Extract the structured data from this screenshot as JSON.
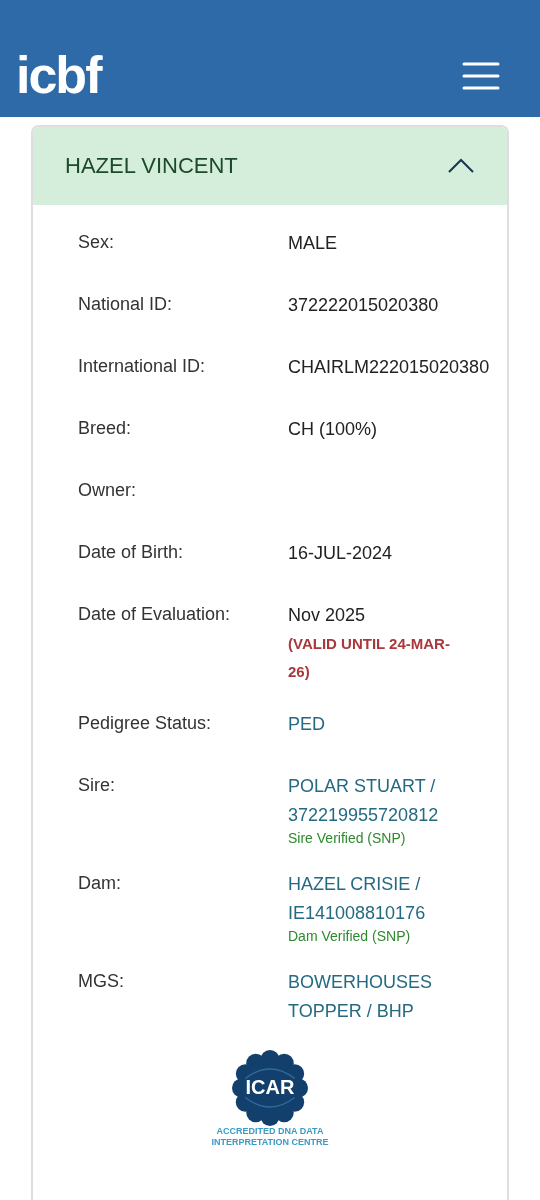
{
  "header": {
    "logo": "icbf"
  },
  "card": {
    "title": "HAZEL VINCENT",
    "expanded": true,
    "rows": [
      {
        "label": "Sex:",
        "value": "MALE",
        "kind": "plain"
      },
      {
        "label": "National ID:",
        "value": "372222015020380",
        "kind": "plain"
      },
      {
        "label": "International ID:",
        "value": "CHAIRLM222015020380",
        "kind": "plain"
      },
      {
        "label": "Breed:",
        "value": "CH (100%)",
        "kind": "plain"
      },
      {
        "label": "Owner:"
      },
      {
        "label": "Date of Birth:",
        "value": "16-JUL-2024",
        "kind": "plain"
      },
      {
        "label": "Date of Evaluation:",
        "value": "Nov 2025",
        "kind": "plain",
        "note": "(VALID UNTIL 24-MAR-26)"
      },
      {
        "label": "Pedigree Status:",
        "value": "PED",
        "kind": "link"
      },
      {
        "label": "Sire:",
        "value": "POLAR STUART / 372219955720812",
        "kind": "link",
        "verification": "Sire Verified (SNP)"
      },
      {
        "label": "Dam:",
        "value": "HAZEL CRISIE / IE141008810176",
        "kind": "link",
        "verification": "Dam Verified (SNP)"
      },
      {
        "label": "MGS:",
        "value": "BOWERHOUSES TOPPER / BHP",
        "kind": "link"
      }
    ],
    "badge": {
      "name": "ICAR",
      "lines": [
        "ACCREDITED DNA DATA",
        "INTERPRETATION CENTRE"
      ]
    }
  }
}
